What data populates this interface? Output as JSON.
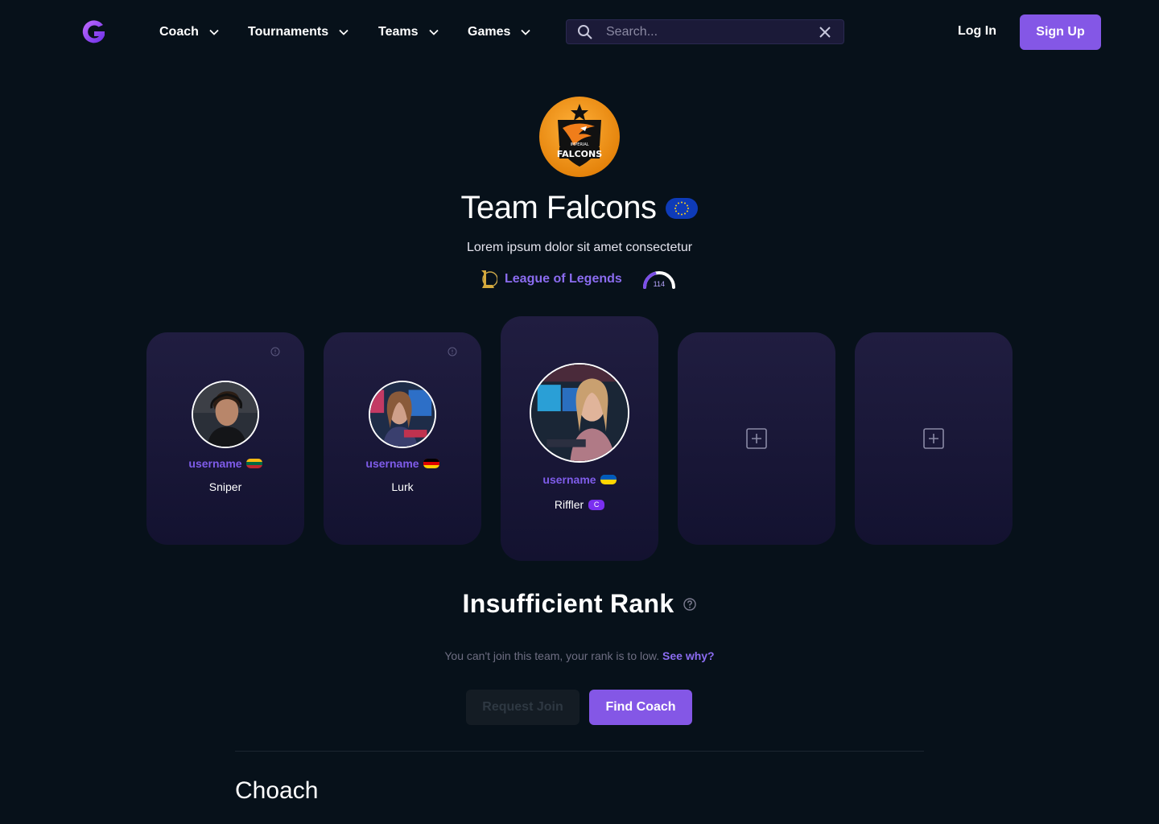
{
  "nav": {
    "logo_letter": "G",
    "items": [
      {
        "label": "Coach"
      },
      {
        "label": "Tournaments"
      },
      {
        "label": "Teams"
      },
      {
        "label": "Games"
      }
    ],
    "search_placeholder": "Search...",
    "login_label": "Log In",
    "signup_label": "Sign Up"
  },
  "team": {
    "logo_text": "FALCONS",
    "logo_subtext": "IMPERIAL",
    "name": "Team Falcons",
    "region_flag": "eu-flag-icon",
    "description": "Lorem ipsum dolor sit amet consectetur",
    "game": "League of Legends",
    "rank_value": "114",
    "rank_fraction": 0.4
  },
  "roster": [
    {
      "username": "username",
      "flag": "lithuania-flag-icon",
      "role": "Sniper",
      "captain": ""
    },
    {
      "username": "username",
      "flag": "germany-flag-icon",
      "role": "Lurk",
      "captain": ""
    },
    {
      "username": "username",
      "flag": "ukraine-flag-icon",
      "role": "Riffler",
      "captain": "C"
    }
  ],
  "rank_section": {
    "title": "Insufficient Rank",
    "message": "You can't join this team, your rank is to low.",
    "see_why": "See why?",
    "request_join_label": "Request Join",
    "find_coach_label": "Find Coach"
  },
  "next_section_title": "Choach",
  "colors": {
    "background": "#07111a",
    "accent": "#8457e6",
    "card": "#1d1b3c"
  }
}
